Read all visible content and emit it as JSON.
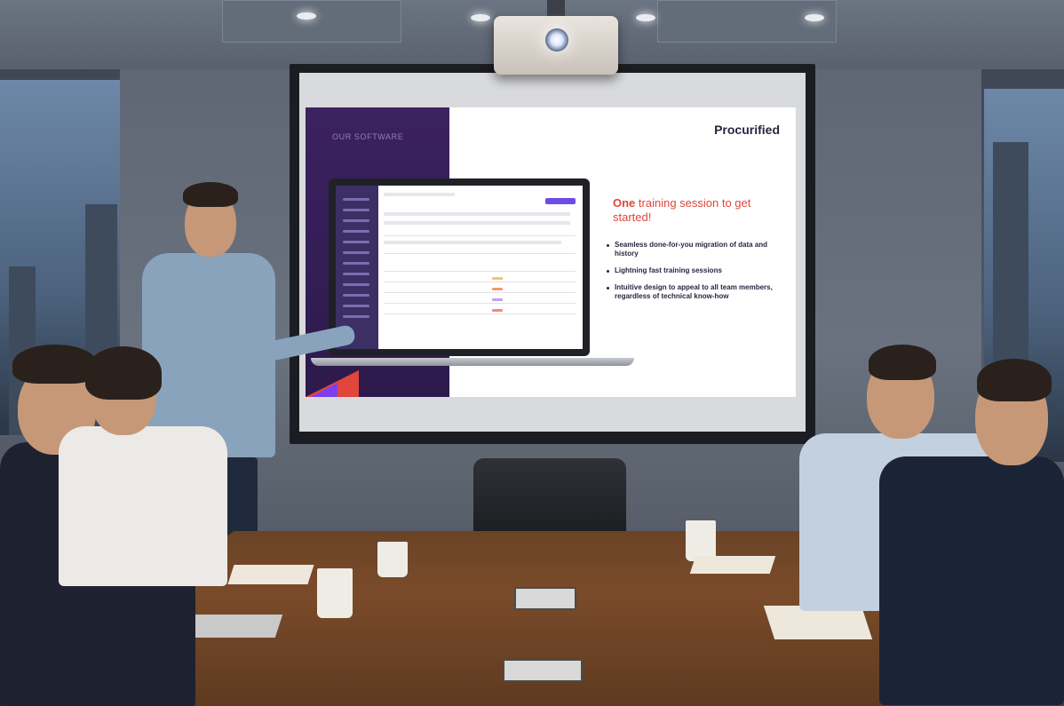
{
  "slide": {
    "kicker": "OUR SOFTWARE",
    "brand": "Procurified",
    "headline_accent": "One",
    "headline_rest": " training session to get started!",
    "bullets": [
      "Seamless done-for-you migration of data and history",
      "Lightning fast training sessions",
      "Intuitive design to appeal to all team members, regardless of technical know-how"
    ]
  },
  "colors": {
    "accent_red": "#e0463a",
    "slide_purple": "#3b2260",
    "brand_text": "#2b2440"
  }
}
